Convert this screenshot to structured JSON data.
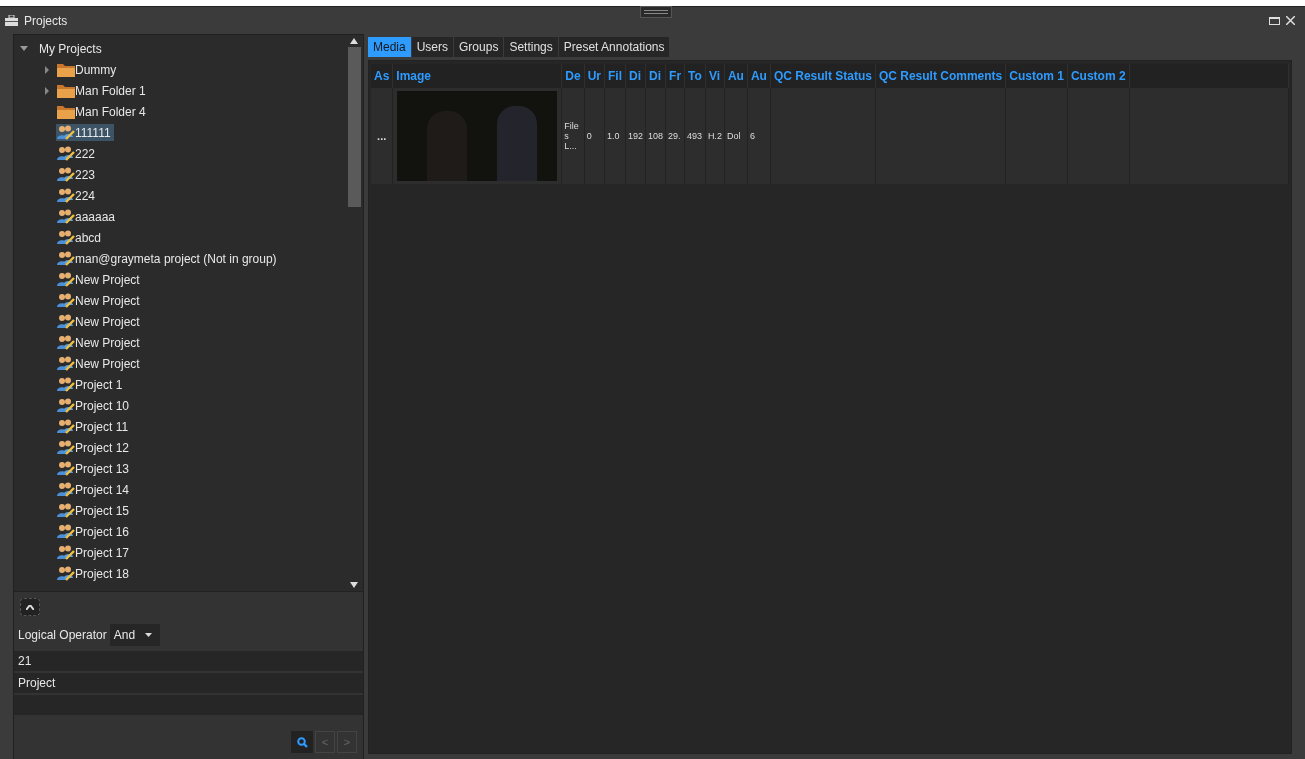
{
  "window": {
    "title": "Projects"
  },
  "tree": [
    {
      "label": "My Projects",
      "expanded": true,
      "selected": false,
      "children": [
        {
          "label": "Dummy",
          "kind": "folder",
          "expanded": false,
          "selected": false
        },
        {
          "label": "Man Folder 1",
          "kind": "folder",
          "expanded": false,
          "selected": false
        },
        {
          "label": "Man Folder 4",
          "kind": "folder",
          "selected": false
        },
        {
          "label": "111111",
          "kind": "project",
          "selected": true
        },
        {
          "label": "222",
          "kind": "project",
          "selected": false
        },
        {
          "label": "223",
          "kind": "project",
          "selected": false
        },
        {
          "label": "224",
          "kind": "project",
          "selected": false
        },
        {
          "label": "aaaaaa",
          "kind": "project",
          "selected": false
        },
        {
          "label": "abcd",
          "kind": "project",
          "selected": false
        },
        {
          "label": "man@graymeta project (Not in group)",
          "kind": "project",
          "selected": false
        },
        {
          "label": "New Project",
          "kind": "project",
          "selected": false
        },
        {
          "label": "New Project",
          "kind": "project",
          "selected": false
        },
        {
          "label": "New Project",
          "kind": "project",
          "selected": false
        },
        {
          "label": "New Project",
          "kind": "project",
          "selected": false
        },
        {
          "label": "New Project",
          "kind": "project",
          "selected": false
        },
        {
          "label": "Project 1",
          "kind": "project",
          "selected": false
        },
        {
          "label": "Project 10",
          "kind": "project",
          "selected": false
        },
        {
          "label": "Project 11",
          "kind": "project",
          "selected": false
        },
        {
          "label": "Project 12",
          "kind": "project",
          "selected": false
        },
        {
          "label": "Project 13",
          "kind": "project",
          "selected": false
        },
        {
          "label": "Project 14",
          "kind": "project",
          "selected": false
        },
        {
          "label": "Project 15",
          "kind": "project",
          "selected": false
        },
        {
          "label": "Project 16",
          "kind": "project",
          "selected": false
        },
        {
          "label": "Project 17",
          "kind": "project",
          "selected": false
        },
        {
          "label": "Project 18",
          "kind": "project",
          "selected": false
        }
      ]
    }
  ],
  "filter": {
    "label": "Logical Operator",
    "operator": "And",
    "fields": [
      "21",
      "Project"
    ]
  },
  "pager": {
    "prev": "<",
    "next": ">",
    "disabled": true
  },
  "tabs": [
    {
      "label": "Media",
      "selected": true
    },
    {
      "label": "Users",
      "selected": false
    },
    {
      "label": "Groups",
      "selected": false
    },
    {
      "label": "Settings",
      "selected": false
    },
    {
      "label": "Preset Annotations",
      "selected": false
    }
  ],
  "table": {
    "columns": [
      {
        "label": "As",
        "kind": "text"
      },
      {
        "label": "Image",
        "kind": "image"
      },
      {
        "label": "De",
        "kind": "text"
      },
      {
        "label": "Ur",
        "kind": "text"
      },
      {
        "label": "Fil",
        "kind": "text"
      },
      {
        "label": "Di",
        "kind": "text"
      },
      {
        "label": "Di",
        "kind": "text"
      },
      {
        "label": "Fr",
        "kind": "text"
      },
      {
        "label": "To",
        "kind": "text"
      },
      {
        "label": "Vi",
        "kind": "text"
      },
      {
        "label": "Au",
        "kind": "text"
      },
      {
        "label": "Au",
        "kind": "text"
      },
      {
        "label": "QC Result Status",
        "kind": "text"
      },
      {
        "label": "QC Result Comments",
        "kind": "text"
      },
      {
        "label": "Custom 1",
        "kind": "text"
      },
      {
        "label": "Custom 2",
        "kind": "text"
      }
    ],
    "rows": [
      {
        "cells": [
          "...",
          null,
          "Files L...",
          "0",
          "1.0",
          "192",
          "108",
          "29.",
          "493",
          "H.2",
          "Dol",
          "6",
          null,
          null,
          null,
          null
        ]
      }
    ]
  }
}
